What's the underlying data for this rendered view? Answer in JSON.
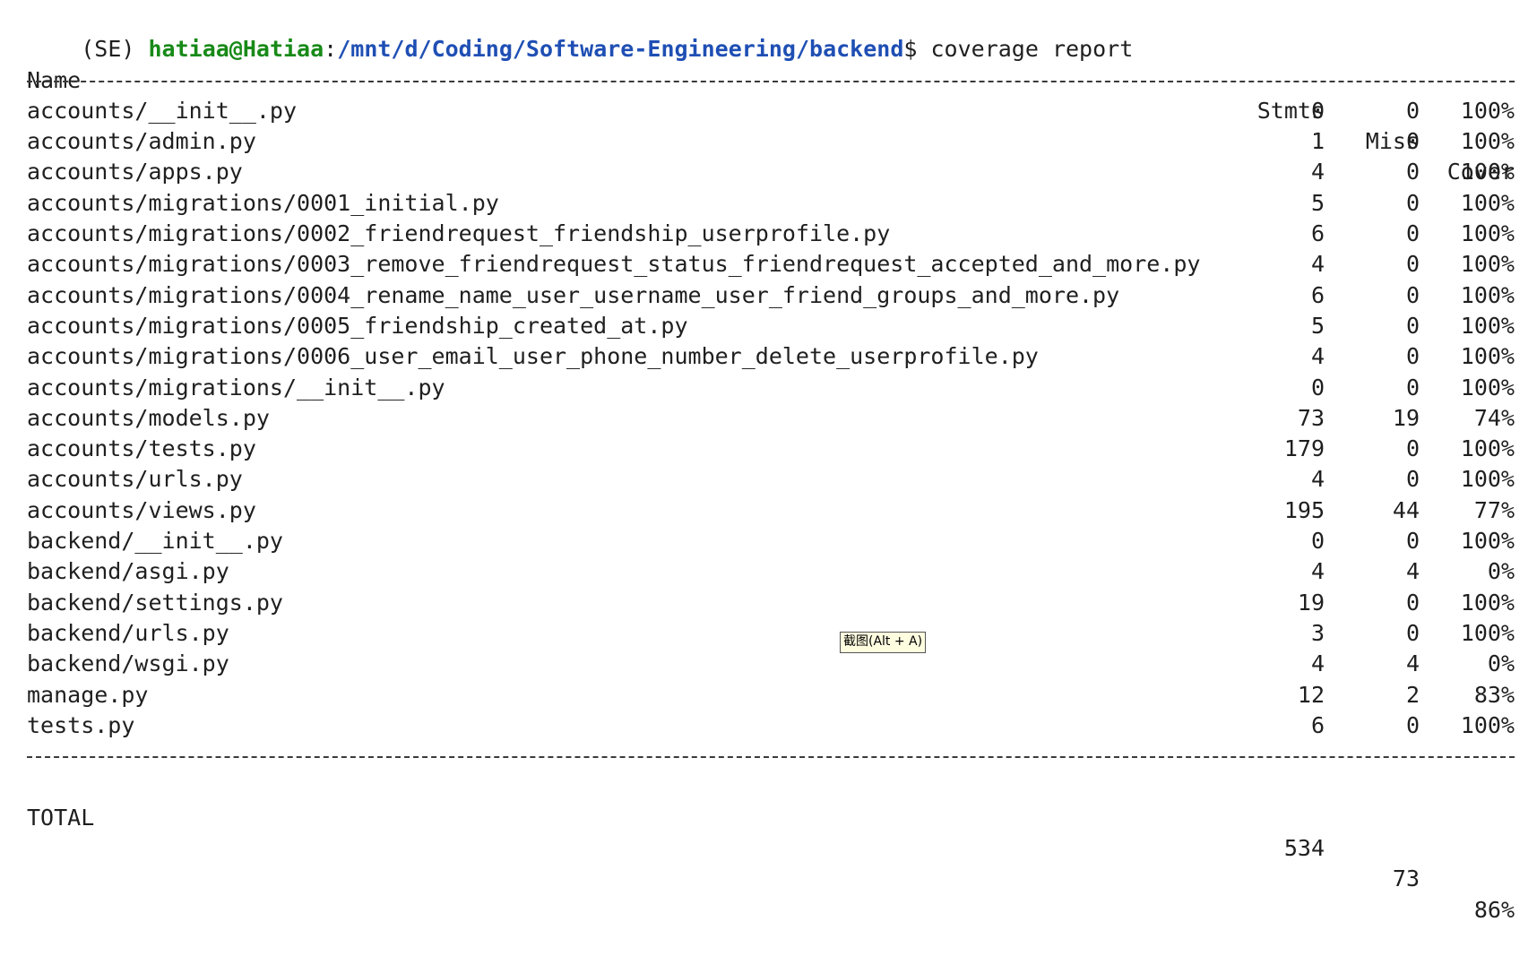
{
  "prompt": {
    "env": "(SE) ",
    "user_host": "hatiaa@Hatiaa",
    "separator": ":",
    "path": "/mnt/d/Coding/Software-Engineering/backend",
    "sign": "$ ",
    "command": "coverage report"
  },
  "report": {
    "headers": {
      "name": "Name",
      "stmts": "Stmts",
      "miss": "Miss",
      "cover": "Cover"
    },
    "rows": [
      {
        "name": "accounts/__init__.py",
        "stmts": "0",
        "miss": "0",
        "cover": "100%"
      },
      {
        "name": "accounts/admin.py",
        "stmts": "1",
        "miss": "0",
        "cover": "100%"
      },
      {
        "name": "accounts/apps.py",
        "stmts": "4",
        "miss": "0",
        "cover": "100%"
      },
      {
        "name": "accounts/migrations/0001_initial.py",
        "stmts": "5",
        "miss": "0",
        "cover": "100%"
      },
      {
        "name": "accounts/migrations/0002_friendrequest_friendship_userprofile.py",
        "stmts": "6",
        "miss": "0",
        "cover": "100%"
      },
      {
        "name": "accounts/migrations/0003_remove_friendrequest_status_friendrequest_accepted_and_more.py",
        "stmts": "4",
        "miss": "0",
        "cover": "100%"
      },
      {
        "name": "accounts/migrations/0004_rename_name_user_username_user_friend_groups_and_more.py",
        "stmts": "6",
        "miss": "0",
        "cover": "100%"
      },
      {
        "name": "accounts/migrations/0005_friendship_created_at.py",
        "stmts": "5",
        "miss": "0",
        "cover": "100%"
      },
      {
        "name": "accounts/migrations/0006_user_email_user_phone_number_delete_userprofile.py",
        "stmts": "4",
        "miss": "0",
        "cover": "100%"
      },
      {
        "name": "accounts/migrations/__init__.py",
        "stmts": "0",
        "miss": "0",
        "cover": "100%"
      },
      {
        "name": "accounts/models.py",
        "stmts": "73",
        "miss": "19",
        "cover": "74%"
      },
      {
        "name": "accounts/tests.py",
        "stmts": "179",
        "miss": "0",
        "cover": "100%"
      },
      {
        "name": "accounts/urls.py",
        "stmts": "4",
        "miss": "0",
        "cover": "100%"
      },
      {
        "name": "accounts/views.py",
        "stmts": "195",
        "miss": "44",
        "cover": "77%"
      },
      {
        "name": "backend/__init__.py",
        "stmts": "0",
        "miss": "0",
        "cover": "100%"
      },
      {
        "name": "backend/asgi.py",
        "stmts": "4",
        "miss": "4",
        "cover": "0%"
      },
      {
        "name": "backend/settings.py",
        "stmts": "19",
        "miss": "0",
        "cover": "100%"
      },
      {
        "name": "backend/urls.py",
        "stmts": "3",
        "miss": "0",
        "cover": "100%"
      },
      {
        "name": "backend/wsgi.py",
        "stmts": "4",
        "miss": "4",
        "cover": "0%"
      },
      {
        "name": "manage.py",
        "stmts": "12",
        "miss": "2",
        "cover": "83%"
      },
      {
        "name": "tests.py",
        "stmts": "6",
        "miss": "0",
        "cover": "100%"
      }
    ],
    "total": {
      "name": "TOTAL",
      "stmts": "534",
      "miss": "73",
      "cover": "86%"
    }
  },
  "tooltip": {
    "text": "截图(Alt + A)"
  }
}
